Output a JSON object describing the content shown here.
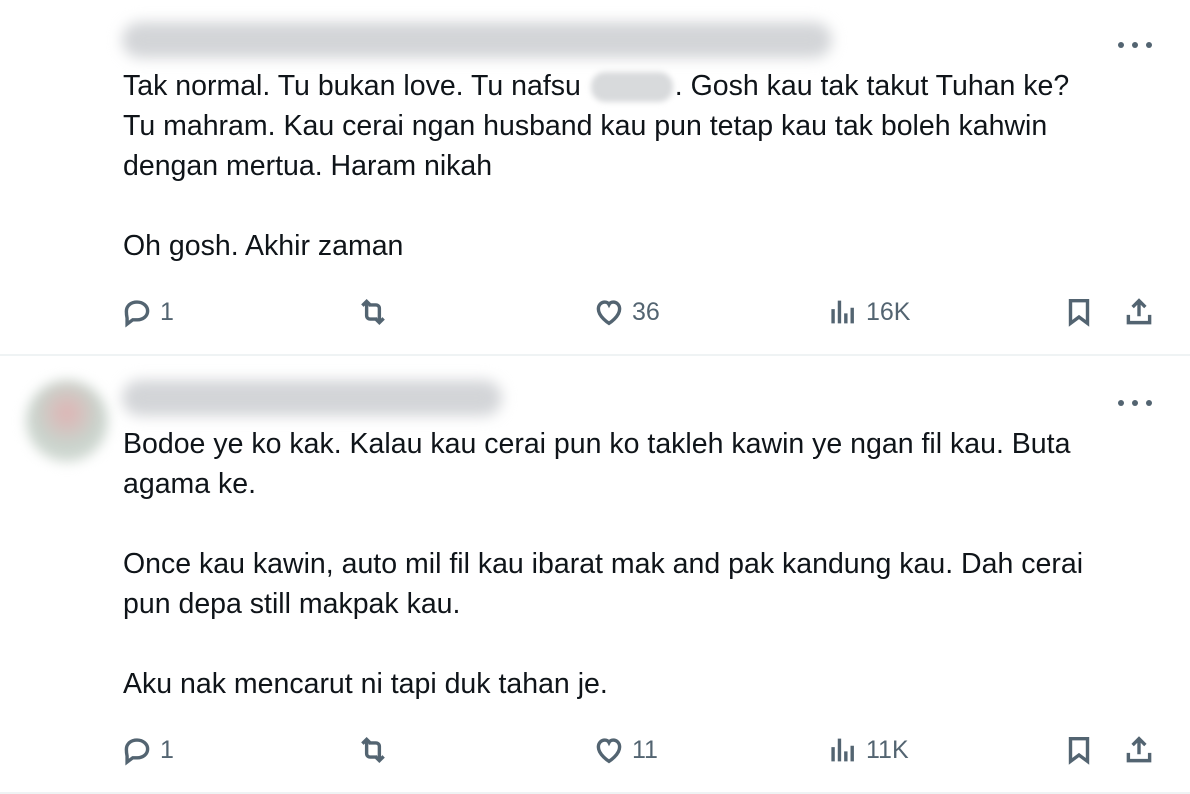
{
  "tweets": [
    {
      "body": [
        "Tak normal. Tu bukan love. Tu nafsu",
        ". Gosh kau tak takut Tuhan ke?",
        "Tu mahram. Kau cerai ngan husband kau pun tetap kau tak boleh kahwin",
        "dengan mertua. Haram nikah",
        "",
        "Oh gosh. Akhir zaman"
      ],
      "replies": "1",
      "likes": "36",
      "views": "16K"
    },
    {
      "body": [
        "Bodoe ye ko kak. Kalau kau cerai pun ko takleh kawin ye ngan fil kau. Buta",
        "agama ke.",
        "",
        "Once kau kawin, auto mil fil kau ibarat mak and pak kandung kau. Dah cerai",
        "pun depa still makpak kau.",
        "",
        "Aku nak mencarut ni tapi duk tahan je."
      ],
      "replies": "1",
      "likes": "11",
      "views": "11K"
    }
  ],
  "icons": {
    "reply": "reply-icon",
    "retweet": "retweet-icon",
    "like": "like-icon",
    "views": "views-icon",
    "bookmark": "bookmark-icon",
    "share": "share-icon",
    "more": "more-icon"
  },
  "colors": {
    "text": "#0f1419",
    "secondary": "#536471",
    "divider": "#eff3f4"
  }
}
